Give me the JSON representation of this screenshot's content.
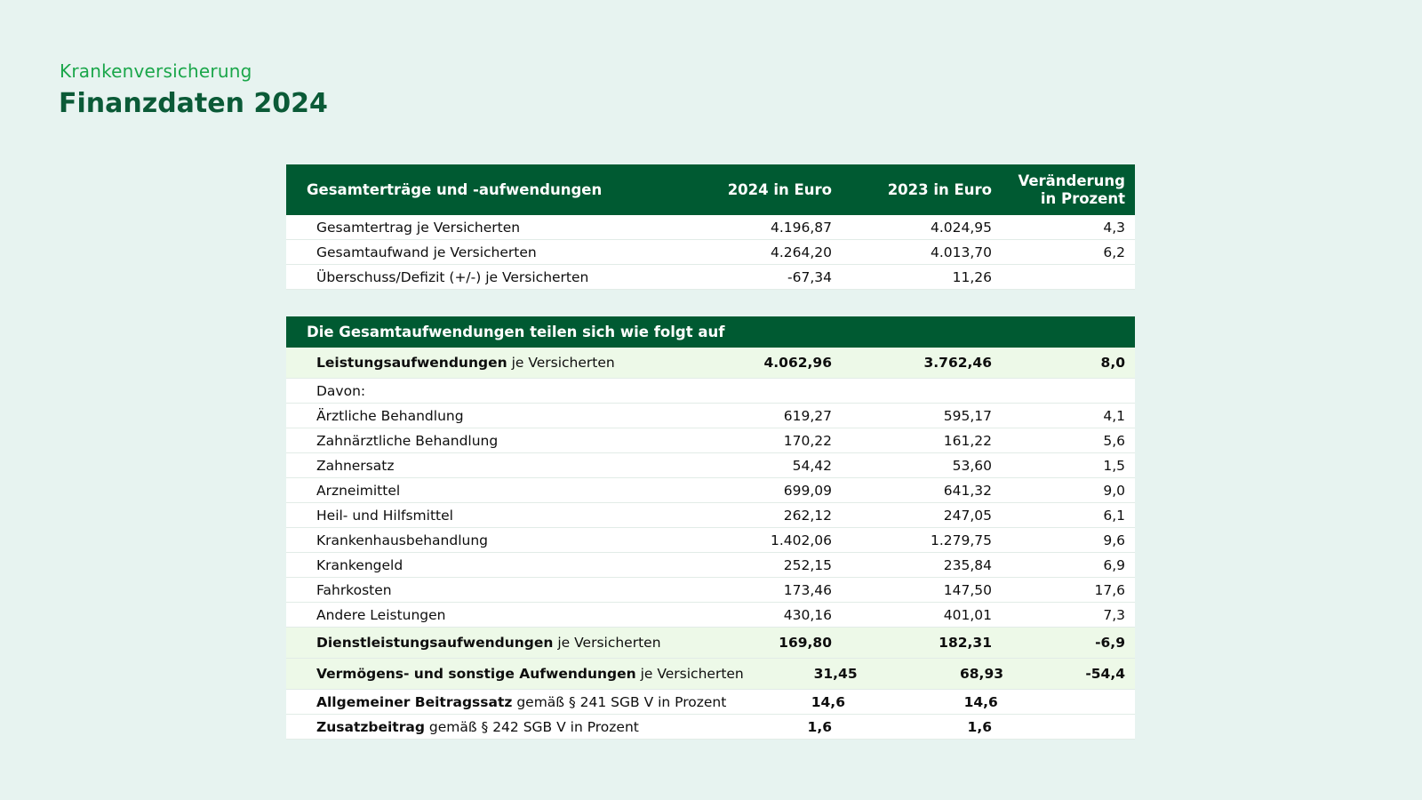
{
  "header": {
    "kicker": "Krankenversicherung",
    "title": "Finanzdaten 2024"
  },
  "colors": {
    "background": "#e7f3f0",
    "header_bg": "#005a32",
    "kicker": "#1aa64a",
    "title": "#0b5a37",
    "highlight_row": "#edf9e8"
  },
  "table1": {
    "col0": "Gesamterträge und -aufwendungen",
    "col1": "2024 in Euro",
    "col2": "2023 in Euro",
    "col3_line1": "Veränderung",
    "col3_line2": "in Prozent",
    "rows": [
      {
        "label": "Gesamtertrag je Versicherten",
        "v2024": "4.196,87",
        "v2023": "4.024,95",
        "change": "4,3"
      },
      {
        "label": "Gesamtaufwand je Versicherten",
        "v2024": "4.264,20",
        "v2023": "4.013,70",
        "change": "6,2"
      },
      {
        "label": "Überschuss/Defizit (+/-) je Versicherten",
        "v2024": "-67,34",
        "v2023": "11,26",
        "change": ""
      }
    ]
  },
  "table2": {
    "heading": "Die Gesamtaufwendungen teilen sich wie folgt auf",
    "leistung": {
      "bold": "Leistungsaufwendungen",
      "rest": " je Versicherten",
      "v2024": "4.062,96",
      "v2023": "3.762,46",
      "change": "8,0"
    },
    "davon": "Davon:",
    "items": [
      {
        "label": "Ärztliche Behandlung",
        "v2024": "619,27",
        "v2023": "595,17",
        "change": "4,1"
      },
      {
        "label": "Zahnärztliche Behandlung",
        "v2024": "170,22",
        "v2023": "161,22",
        "change": "5,6"
      },
      {
        "label": "Zahnersatz",
        "v2024": "54,42",
        "v2023": "53,60",
        "change": "1,5"
      },
      {
        "label": "Arzneimittel",
        "v2024": "699,09",
        "v2023": "641,32",
        "change": "9,0"
      },
      {
        "label": "Heil- und Hilfsmittel",
        "v2024": "262,12",
        "v2023": "247,05",
        "change": "6,1"
      },
      {
        "label": "Krankenhausbehandlung",
        "v2024": "1.402,06",
        "v2023": "1.279,75",
        "change": "9,6"
      },
      {
        "label": "Krankengeld",
        "v2024": "252,15",
        "v2023": "235,84",
        "change": "6,9"
      },
      {
        "label": "Fahrkosten",
        "v2024": "173,46",
        "v2023": "147,50",
        "change": "17,6"
      },
      {
        "label": "Andere Leistungen",
        "v2024": "430,16",
        "v2023": "401,01",
        "change": "7,3"
      }
    ],
    "dienst": {
      "bold": "Dienstleistungsaufwendungen",
      "rest": " je Versicherten",
      "v2024": "169,80",
      "v2023": "182,31",
      "change": "-6,9"
    },
    "vermoegen": {
      "bold": "Vermögens- und sonstige Aufwendungen",
      "rest": " je Versicherten",
      "v2024": "31,45",
      "v2023": "68,93",
      "change": "-54,4"
    },
    "beitragssatz": {
      "bold": "Allgemeiner Beitragssatz",
      "rest": " gemäß § 241 SGB V in Prozent",
      "v2024": "14,6",
      "v2023": "14,6",
      "change": ""
    },
    "zusatz": {
      "bold": "Zusatzbeitrag",
      "rest": " gemäß § 242 SGB V in Prozent",
      "v2024": "1,6",
      "v2023": "1,6",
      "change": ""
    }
  }
}
